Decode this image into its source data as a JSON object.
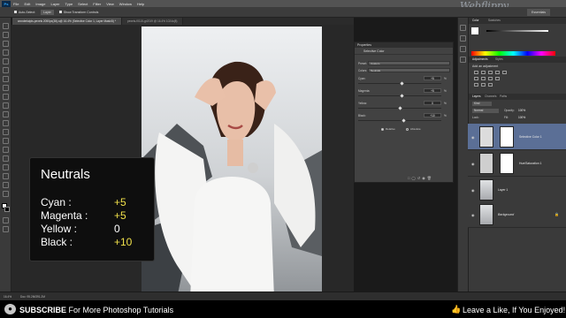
{
  "brand": "Webflippy",
  "menu": [
    "File",
    "Edit",
    "Image",
    "Layer",
    "Type",
    "Select",
    "Filter",
    "View",
    "Window",
    "Help"
  ],
  "app_icon": "Ps",
  "options_bar": {
    "auto_select": "Auto-Select:",
    "auto_select_value": "Layer",
    "show_transform": "Show Transform Controls"
  },
  "workspace": "Essentials",
  "doc_tabs": [
    {
      "label": "wonderlaipis-pexels 2050px(38)-s@ 16.4% (Selective Color 1, Layer Mask/8) *",
      "active": true
    },
    {
      "label": "pexels-f0115-gr2019 @ 16.4% 1024x(8)",
      "active": false
    }
  ],
  "overlay": {
    "title": "Neutrals",
    "rows": [
      {
        "label": "Cyan :",
        "value": "+5"
      },
      {
        "label": "Magenta :",
        "value": "+5"
      },
      {
        "label": "Yellow :",
        "value": "0"
      },
      {
        "label": "Black :",
        "value": "+10"
      }
    ]
  },
  "properties": {
    "panel_title": "Properties",
    "subtitle": "Selective Color",
    "preset_label": "Preset:",
    "preset_value": "Custom",
    "colors_label": "Colors:",
    "colors_value": "Neutrals",
    "sliders": [
      {
        "label": "Cyan:",
        "value": "+5",
        "pct": 0.525
      },
      {
        "label": "Magenta:",
        "value": "+5",
        "pct": 0.525
      },
      {
        "label": "Yellow:",
        "value": "0",
        "pct": 0.5
      },
      {
        "label": "Black:",
        "value": "+10",
        "pct": 0.55
      }
    ],
    "unit": "%",
    "method_relative": "Relative",
    "method_absolute": "Absolute",
    "method_selected": "relative"
  },
  "right_panels": {
    "color_tabs": [
      "Color",
      "Swatches"
    ],
    "adjust_tabs": [
      "Adjustments",
      "Styles"
    ],
    "adjust_hint": "Add an adjustment",
    "layer_tabs": [
      "Layers",
      "Channels",
      "Paths"
    ],
    "kind": "Kind",
    "blend_mode": "Normal",
    "opacity_label": "Opacity:",
    "opacity_value": "100%",
    "lock_label": "Lock:",
    "fill_label": "Fill:",
    "fill_value": "100%",
    "layers": [
      {
        "name": "Selective Color 1",
        "selected": true
      },
      {
        "name": "Hue/Saturation 1",
        "selected": false
      },
      {
        "name": "Layer 1",
        "selected": false
      },
      {
        "name": "Background",
        "selected": false
      }
    ]
  },
  "status": {
    "zoom": "16.4%",
    "doc": "Doc: 95.2M/391.2M"
  },
  "banner": {
    "subscribe_bold": "SUBSCRIBE",
    "subscribe_rest": " For More Photoshop Tutorials",
    "like": "Leave a Like, If You Enjoyed!"
  },
  "colors": {
    "accent_yellow": "#f0e04a",
    "layer_selected": "#5b6f96"
  }
}
